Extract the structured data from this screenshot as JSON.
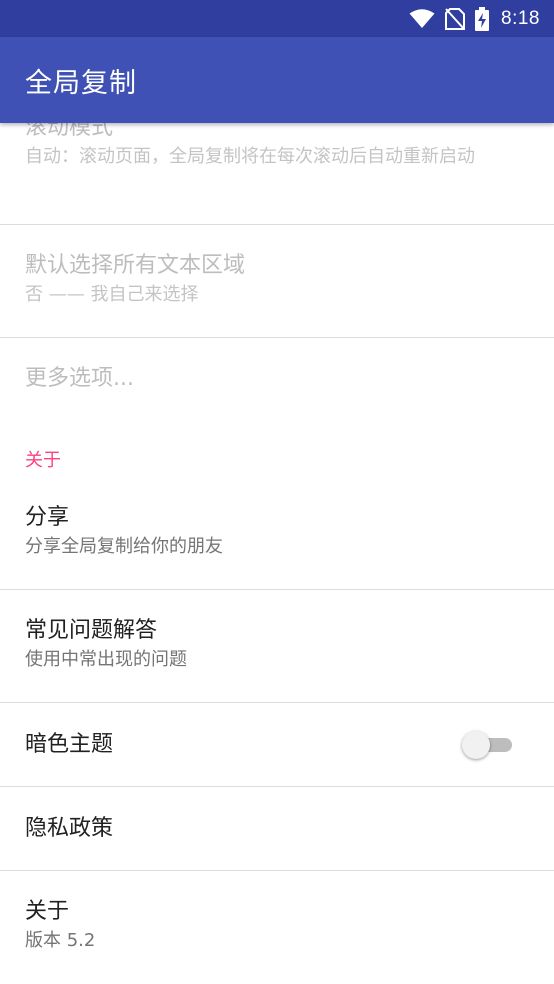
{
  "status_bar": {
    "time": "8:18",
    "icons": [
      "wifi-icon",
      "no-sim-icon",
      "battery-charging-icon"
    ]
  },
  "app_bar": {
    "title": "全局复制"
  },
  "preferences": {
    "scroll_mode": {
      "title": "滚动模式",
      "summary": "自动：滚动页面，全局复制将在每次滚动后自动重新启动",
      "enabled": false
    },
    "select_all": {
      "title": "默认选择所有文本区域",
      "summary": "否 —— 我自己来选择",
      "enabled": false
    },
    "more_options": {
      "title": "更多选项...",
      "enabled": false
    },
    "about_category": "关于",
    "share": {
      "title": "分享",
      "summary": "分享全局复制给你的朋友"
    },
    "faq": {
      "title": "常见问题解答",
      "summary": "使用中常出现的问题"
    },
    "dark_theme": {
      "title": "暗色主题",
      "checked": false
    },
    "privacy": {
      "title": "隐私政策"
    },
    "about": {
      "title": "关于",
      "summary": "版本 5.2"
    }
  },
  "colors": {
    "status_bar": "#303f9f",
    "primary": "#3f51b5",
    "accent": "#ff4081"
  }
}
